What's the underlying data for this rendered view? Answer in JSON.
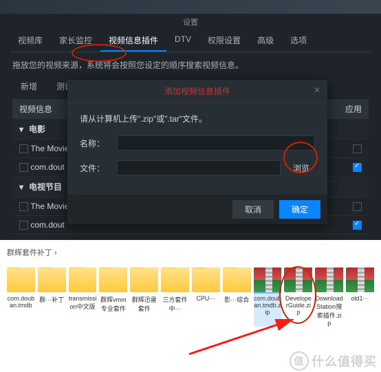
{
  "window": {
    "title": "设置"
  },
  "tabs": [
    "视频库",
    "家长监控",
    "视频信息插件",
    "DTV",
    "权限设置",
    "高级",
    "选项"
  ],
  "active_tab": "视频信息插件",
  "description": "拖放您的视频来源，系统将会按照您设定的顺序搜索视频信息。",
  "subtabs": {
    "add": "新增",
    "test": "测试"
  },
  "list": {
    "hdr_name": "视频信息",
    "hdr_use": "应用",
    "groups": [
      {
        "label": "电影",
        "rows": [
          {
            "name": "The Movie",
            "checked": false
          },
          {
            "name": "com.dout",
            "checked": true
          }
        ]
      },
      {
        "label": "电视节目",
        "rows": [
          {
            "name": "The Movie",
            "checked": false
          },
          {
            "name": "com.dout",
            "checked": true
          }
        ]
      }
    ]
  },
  "modal": {
    "title": "添加视频信息插件",
    "desc": "请从计算机上传\".zip\"或\".tar\"文件。",
    "name_label": "名称：",
    "file_label": "文件：",
    "name_value": "",
    "file_value": "",
    "browse": "浏览",
    "cancel": "取消",
    "ok": "确定"
  },
  "explorer": {
    "breadcrumb": "群辉套件补丁  ›",
    "files": [
      {
        "type": "folder",
        "label": "com.douban.tmdb"
      },
      {
        "type": "folder",
        "label": "群···补丁"
      },
      {
        "type": "folder",
        "label": "transmission中文版"
      },
      {
        "type": "folder",
        "label": "群辉vmm专业套件"
      },
      {
        "type": "folder",
        "label": "群辉迅雷套件"
      },
      {
        "type": "folder",
        "label": "三方套件中···"
      },
      {
        "type": "folder",
        "label": "CPU···"
      },
      {
        "type": "folder",
        "label": "影···综合"
      },
      {
        "type": "zip",
        "label": "com.douban.tmdb.zip",
        "selected": true
      },
      {
        "type": "zip",
        "label": "DeveloperGuide.zip"
      },
      {
        "type": "zip",
        "label": "DownloadStation搜索插件.zip"
      },
      {
        "type": "zip",
        "label": "old1···"
      }
    ]
  },
  "watermark": {
    "glyph": "值",
    "text": "什么值得买"
  }
}
